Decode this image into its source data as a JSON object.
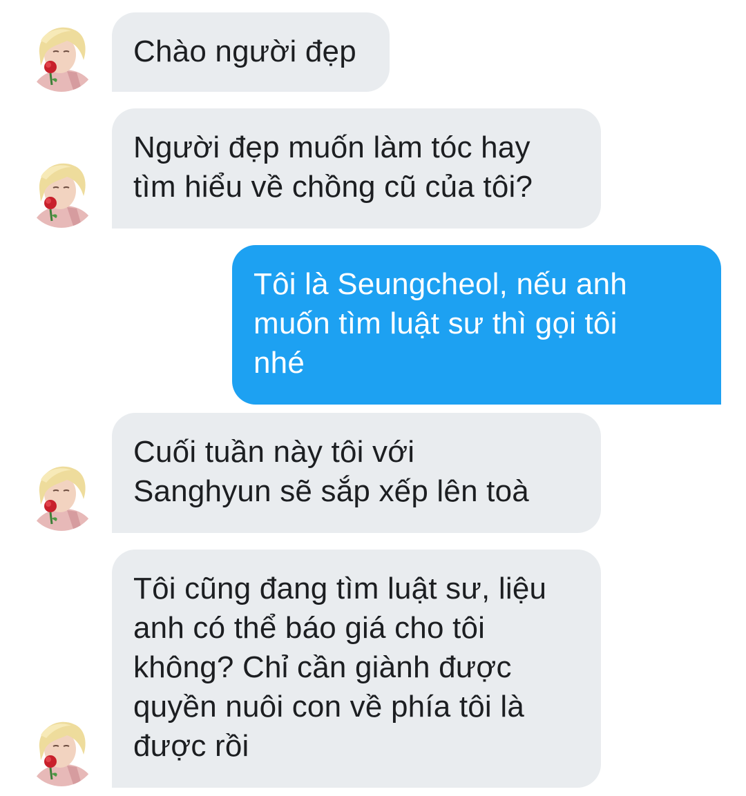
{
  "conversation": {
    "messages": [
      {
        "direction": "incoming",
        "text": "Chào người đẹp"
      },
      {
        "direction": "incoming",
        "text": "Người đẹp muốn làm tóc hay\ntìm hiểu về chồng cũ của tôi?"
      },
      {
        "direction": "outgoing",
        "text": "Tôi là Seungcheol, nếu anh\nmuốn tìm luật sư thì gọi tôi\nnhé"
      },
      {
        "direction": "incoming",
        "text": "Cuối tuần này tôi với\nSanghyun sẽ sắp xếp lên toà"
      },
      {
        "direction": "incoming",
        "text": "Tôi cũng đang tìm luật sư, liệu\nanh có thể báo giá cho tôi\nkhông? Chỉ cần giành được\nquyền nuôi con về phía tôi là\nđược rồi"
      }
    ]
  },
  "colors": {
    "incoming_bubble": "#e9ecef",
    "incoming_text": "#1c1e21",
    "outgoing_bubble": "#1da1f2",
    "outgoing_text": "#ffffff",
    "background": "#ffffff"
  },
  "icons": {
    "contact_avatar": "avatar-blonde-person-with-red-rose"
  }
}
